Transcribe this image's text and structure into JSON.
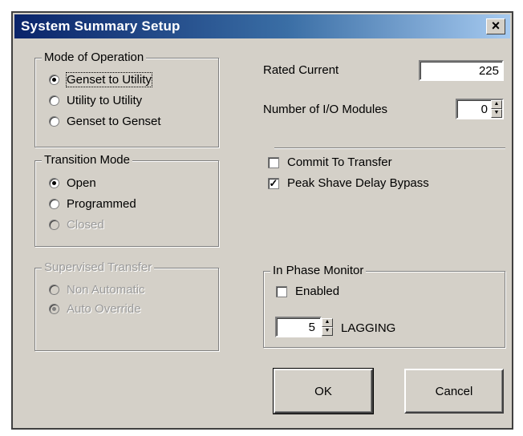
{
  "window": {
    "title": "System Summary Setup",
    "close_glyph": "×"
  },
  "mode_of_operation": {
    "legend": "Mode of Operation",
    "options": [
      "Genset to Utility",
      "Utility to Utility",
      "Genset to Genset"
    ],
    "selected": "Genset to Utility"
  },
  "transition_mode": {
    "legend": "Transition Mode",
    "options": [
      "Open",
      "Programmed",
      "Closed"
    ],
    "selected": "Open"
  },
  "supervised_transfer": {
    "legend": "Supervised Transfer",
    "options": [
      "Non Automatic",
      "Auto Override"
    ],
    "selected": "Auto Override"
  },
  "rated_current": {
    "label": "Rated Current",
    "value": "225"
  },
  "io_modules": {
    "label": "Number of I/O Modules",
    "value": "0"
  },
  "commit_to_transfer": {
    "label": "Commit To Transfer",
    "checked": false
  },
  "peak_shave": {
    "label": "Peak Shave Delay Bypass",
    "checked": true,
    "mark": "✓"
  },
  "in_phase_monitor": {
    "legend": "In Phase Monitor",
    "enabled_label": "Enabled",
    "enabled": false,
    "value": "5",
    "unit_label": "LAGGING"
  },
  "buttons": {
    "ok": "OK",
    "cancel": "Cancel"
  },
  "icons": {
    "spin_up": "▲",
    "spin_down": "▼"
  }
}
